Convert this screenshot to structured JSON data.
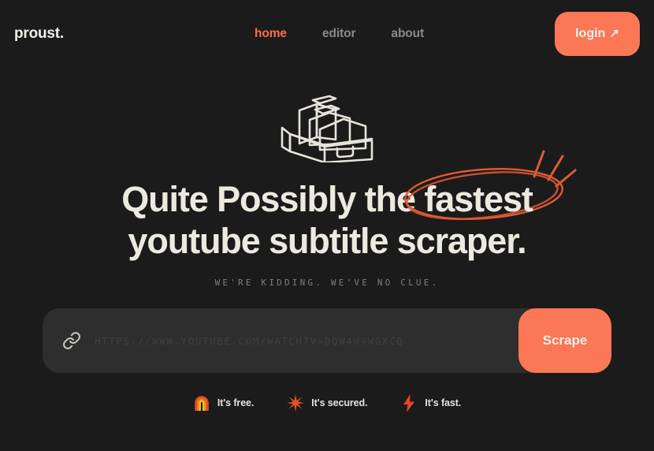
{
  "theme": {
    "background": "#1b1b1b",
    "accent": "#fb7755",
    "accent_text": "#fb6f46",
    "text_primary": "#eceadf",
    "text_muted": "#8a8a86",
    "field_background": "#2e2e2e"
  },
  "header": {
    "logo": "proust.",
    "nav": [
      {
        "label": "home",
        "active": true
      },
      {
        "label": "editor",
        "active": false
      },
      {
        "label": "about",
        "active": false
      }
    ],
    "login": {
      "label": "login",
      "arrow": "↗"
    }
  },
  "hero": {
    "illustration": "filing-cabinet",
    "headline_line1_before": "Quite Possibly the ",
    "headline_highlight": "fastest",
    "headline_line2": "youtube subtitle scraper.",
    "subtitle": "WE'RE KIDDING. WE'VE NO CLUE."
  },
  "search": {
    "icon": "link-icon",
    "placeholder": "https://www.youtube.com/watch?v=dQw4w9WgXcQ",
    "value": "",
    "submit_label": "Scrape"
  },
  "badges": [
    {
      "icon": "rainbow-icon",
      "label": "It's free."
    },
    {
      "icon": "sparkle-icon",
      "label": "It's secured."
    },
    {
      "icon": "lightning-icon",
      "label": "It's fast."
    }
  ]
}
